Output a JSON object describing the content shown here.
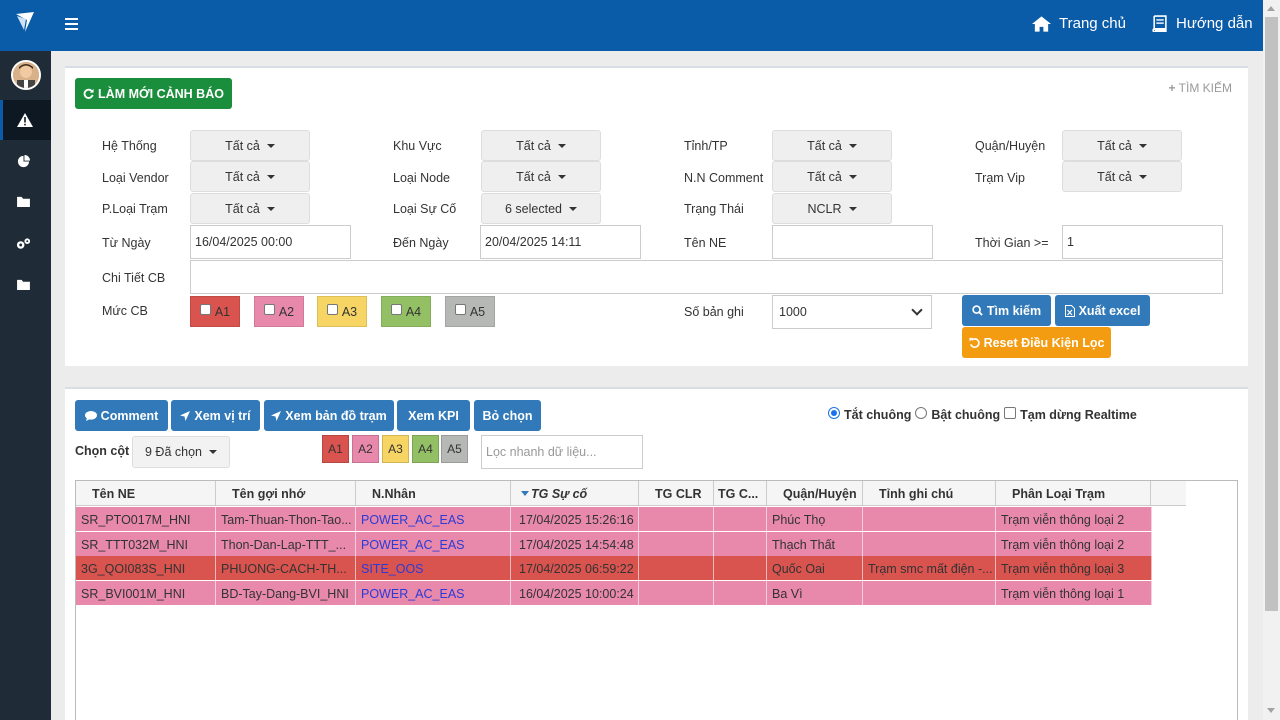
{
  "colors": {
    "brand": "#0a5ba8",
    "sidebar": "#1f2b36",
    "green": "#1a8e3c",
    "blue": "#3179b8",
    "orange": "#f39c12",
    "a1": "#d9534f",
    "a2": "#e888aa",
    "a3": "#f7d564",
    "a4": "#93c065",
    "a5": "#b5b8b5"
  },
  "topbar": {
    "home_label": "Trang chủ",
    "guide_label": "Hướng dẫn"
  },
  "sidebar": {
    "items": [
      {
        "icon": "warning-icon"
      },
      {
        "icon": "pie-chart-icon"
      },
      {
        "icon": "folder-icon"
      },
      {
        "icon": "cogs-icon"
      },
      {
        "icon": "folder-icon"
      }
    ]
  },
  "filter": {
    "refresh_label": "LÀM MỚI CẢNH BÁO",
    "search_toggle": "TÌM KIẾM",
    "he_thong": {
      "label": "Hệ Thống",
      "value": "Tất cả"
    },
    "khu_vuc": {
      "label": "Khu Vực",
      "value": "Tất cả"
    },
    "tinh_tp": {
      "label": "Tỉnh/TP",
      "value": "Tất cả"
    },
    "quan_huyen": {
      "label": "Quận/Huyện",
      "value": "Tất cả"
    },
    "loai_vendor": {
      "label": "Loại Vendor",
      "value": "Tất cả"
    },
    "loai_node": {
      "label": "Loại Node",
      "value": "Tất cả"
    },
    "nn_comment": {
      "label": "N.N Comment",
      "value": "Tất cả"
    },
    "tram_vip": {
      "label": "Trạm Vip",
      "value": "Tất cả"
    },
    "ploai_tram": {
      "label": "P.Loại Trạm",
      "value": "Tất cả"
    },
    "loai_su_co": {
      "label": "Loại Sự Cố",
      "value": "6 selected"
    },
    "trang_thai": {
      "label": "Trạng Thái",
      "value": "NCLR"
    },
    "tu_ngay": {
      "label": "Từ Ngày",
      "value": "16/04/2025 00:00"
    },
    "den_ngay": {
      "label": "Đến Ngày",
      "value": "20/04/2025 14:11"
    },
    "ten_ne": {
      "label": "Tên NE",
      "value": ""
    },
    "thoi_gian": {
      "label": "Thời Gian >=",
      "value": "1"
    },
    "chi_tiet_cb": {
      "label": "Chi Tiết CB",
      "value": ""
    },
    "muc_cb": {
      "label": "Mức CB",
      "levels": [
        "A1",
        "A2",
        "A3",
        "A4",
        "A5"
      ]
    },
    "so_ban_ghi": {
      "label": "Số bản ghi",
      "value": "1000"
    },
    "search_btn": "Tìm kiếm",
    "export_btn": "Xuất excel",
    "reset_btn": "Reset Điều Kiện Lọc"
  },
  "results": {
    "actions": [
      "Comment",
      "Xem vị trí",
      "Xem bản đồ trạm",
      "Xem KPI",
      "Bỏ chọn"
    ],
    "sound_off": "Tắt chuông",
    "sound_on": "Bật chuông",
    "pause_realtime": "Tạm dừng Realtime",
    "choose_cols_label": "Chọn cột",
    "choose_cols_value": "9 Đã chọn",
    "quick_levels": [
      "A1",
      "A2",
      "A3",
      "A4",
      "A5"
    ],
    "quick_filter_placeholder": "Lọc nhanh dữ liệu...",
    "columns": [
      "Tên NE",
      "Tên gợi nhớ",
      "N.Nhân",
      "TG Sự cố",
      "TG CLR",
      "TG C...",
      "Quận/Huyện",
      "Tỉnh ghi chú",
      "Phân Loại Trạm"
    ],
    "rows": [
      {
        "ne": "SR_PTO017M_HNI",
        "alias": "Tam-Thuan-Thon-Tao...",
        "cause": "POWER_AC_EAS",
        "time": "17/04/2025 15:26:16",
        "clr": "",
        "tgc": "",
        "district": "Phúc Thọ",
        "note": "",
        "type": "Trạm viễn thông loại 2",
        "level": "A2"
      },
      {
        "ne": "SR_TTT032M_HNI",
        "alias": "Thon-Dan-Lap-TTT_...",
        "cause": "POWER_AC_EAS",
        "time": "17/04/2025 14:54:48",
        "clr": "",
        "tgc": "",
        "district": "Thạch Thất",
        "note": "",
        "type": "Trạm viễn thông loại 2",
        "level": "A2"
      },
      {
        "ne": "3G_QOI083S_HNI",
        "alias": "PHUONG-CACH-TH...",
        "cause": "SITE_OOS",
        "time": "17/04/2025 06:59:22",
        "clr": "",
        "tgc": "",
        "district": "Quốc Oai",
        "note": "Trạm smc mất điện -...",
        "type": "Trạm viễn thông loại 3",
        "level": "A1"
      },
      {
        "ne": "SR_BVI001M_HNI",
        "alias": "BD-Tay-Dang-BVI_HNI",
        "cause": "POWER_AC_EAS",
        "time": "16/04/2025 10:00:24",
        "clr": "",
        "tgc": "",
        "district": "Ba Vì",
        "note": "",
        "type": "Trạm viễn thông loại 1",
        "level": "A2"
      }
    ]
  }
}
